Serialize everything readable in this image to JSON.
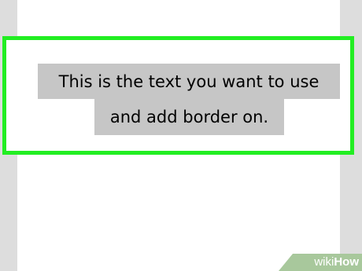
{
  "document": {
    "selected_text_line1": "This is the text you want to use",
    "selected_text_line2": "and add border on."
  },
  "watermark": {
    "wiki": "wiki",
    "how": "How"
  },
  "colors": {
    "highlight_border": "#22ee22",
    "selection_background": "#c6c6c6",
    "workspace_background": "#dddddd",
    "page_background": "#ffffff"
  }
}
